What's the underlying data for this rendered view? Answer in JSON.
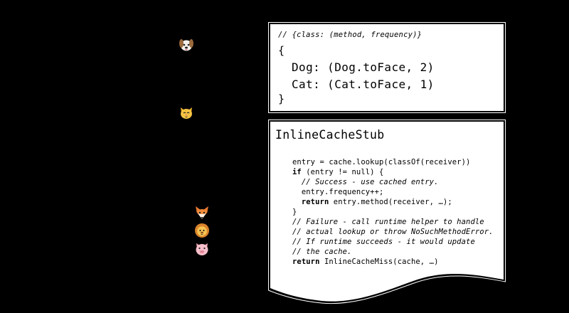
{
  "receivers": [
    {
      "name": "dog",
      "icon": "dog-face-icon"
    },
    {
      "name": "cat",
      "icon": "cat-face-icon"
    },
    {
      "name": "fox",
      "icon": "fox-face-icon"
    },
    {
      "name": "lion",
      "icon": "lion-face-icon"
    },
    {
      "name": "pig",
      "icon": "pig-face-icon"
    }
  ],
  "cache": {
    "comment": "// {class: (method, frequency)}",
    "open_brace": "{",
    "close_brace": "}",
    "entries": [
      {
        "text": "Dog: (Dog.toFace, 2)"
      },
      {
        "text": "Cat: (Cat.toFace, 1)"
      }
    ]
  },
  "stub": {
    "title": "InlineCacheStub",
    "lines": [
      [
        {
          "t": "entry = cache.lookup(classOf(receiver))",
          "k": "plain"
        }
      ],
      [
        {
          "t": "if",
          "k": "kw"
        },
        {
          "t": " (entry != null) {",
          "k": "plain"
        }
      ],
      [
        {
          "t": "  // Success - use cached entry.",
          "k": "cm"
        }
      ],
      [
        {
          "t": "  entry.frequency++;",
          "k": "plain"
        }
      ],
      [
        {
          "t": "  ",
          "k": "plain"
        },
        {
          "t": "return",
          "k": "kw"
        },
        {
          "t": " entry.method(receiver, …);",
          "k": "plain"
        }
      ],
      [
        {
          "t": "}",
          "k": "plain"
        }
      ],
      [
        {
          "t": "// Failure - call runtime helper to handle",
          "k": "cm"
        }
      ],
      [
        {
          "t": "// actual lookup or throw NoSuchMethodError.",
          "k": "cm"
        }
      ],
      [
        {
          "t": "// If runtime succeeds - it would update",
          "k": "cm"
        }
      ],
      [
        {
          "t": "// the cache.",
          "k": "cm"
        }
      ],
      [
        {
          "t": "return",
          "k": "kw"
        },
        {
          "t": " InlineCacheMiss(cache, …)",
          "k": "plain"
        }
      ]
    ]
  },
  "colors": {
    "background": "#000000",
    "card": "#ffffff",
    "text": "#000000"
  }
}
